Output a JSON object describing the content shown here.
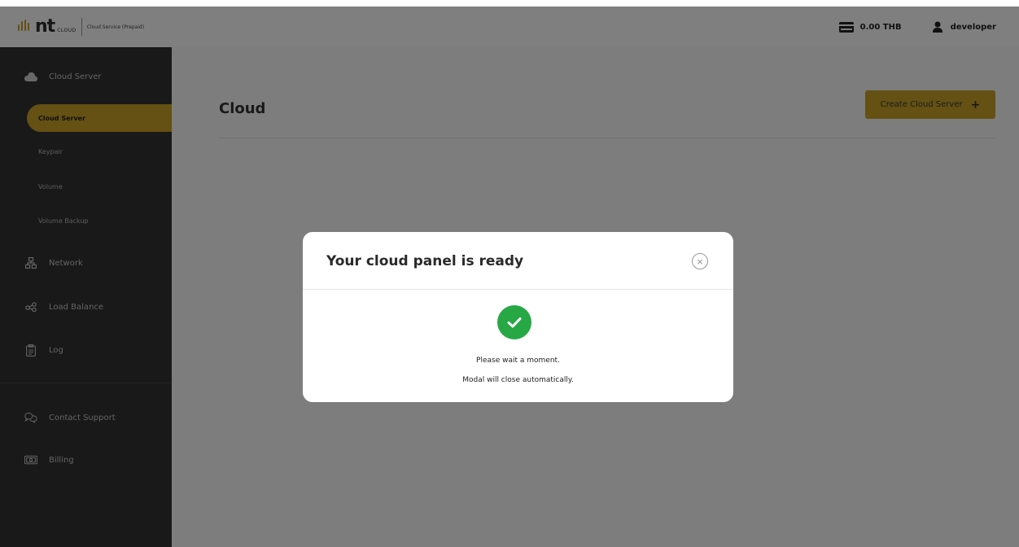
{
  "header": {
    "logo_text": "nt",
    "logo_sub": "CLOUD",
    "service_label": "Cloud Service (Prepaid)",
    "balance": "0.00 THB",
    "username": "developer"
  },
  "sidebar": {
    "sections": [
      {
        "label": "Cloud Server",
        "icon": "cloud-icon"
      },
      {
        "label": "Network",
        "icon": "network-icon"
      },
      {
        "label": "Load Balance",
        "icon": "load-balance-icon"
      },
      {
        "label": "Log",
        "icon": "clipboard-icon"
      },
      {
        "label": "Contact Support",
        "icon": "chat-icon"
      },
      {
        "label": "Billing",
        "icon": "money-icon"
      }
    ],
    "sub_items": [
      {
        "label": "Cloud Server",
        "active": true
      },
      {
        "label": "Keypair"
      },
      {
        "label": "Volume"
      },
      {
        "label": "Volume Backup"
      }
    ]
  },
  "main": {
    "title": "Cloud",
    "create_button": "Create Cloud Server",
    "create_plus": "+"
  },
  "modal": {
    "title": "Your cloud panel is ready",
    "close_glyph": "×",
    "message_line1": "Please wait a moment.",
    "message_line2": "Modal will close automatically."
  },
  "colors": {
    "accent": "#c9a227",
    "sidebar_bg": "#333333",
    "success": "#27a845"
  }
}
